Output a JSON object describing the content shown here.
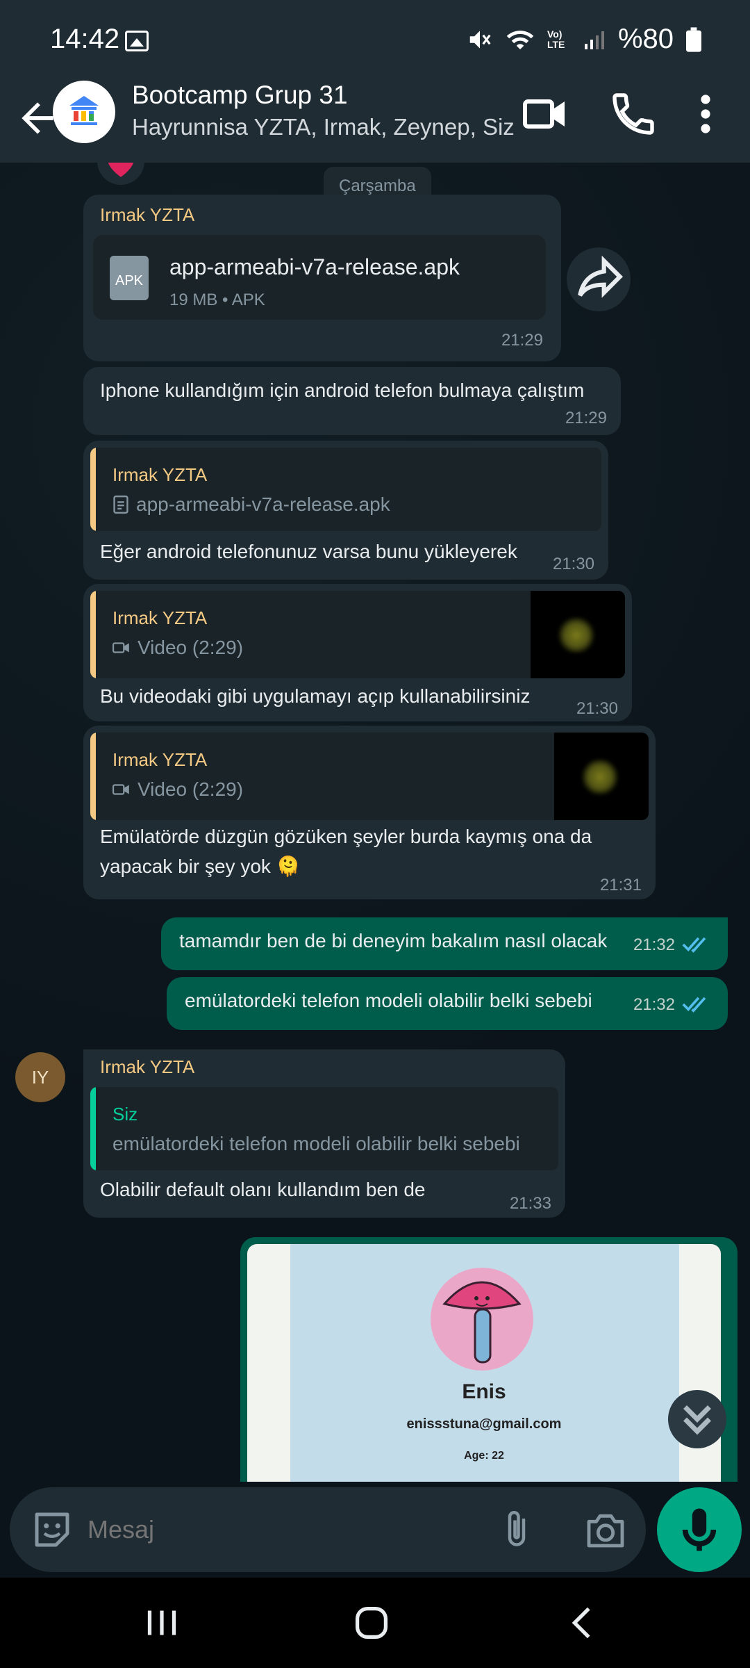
{
  "status_bar": {
    "time": "14:42",
    "battery": "%80",
    "network": "Vo) LTE"
  },
  "header": {
    "title": "Bootcamp Grup 31",
    "subtitle": "Hayrunnisa YZTA, Irmak, Zeynep, Siz"
  },
  "chat": {
    "date_chip": "Çarşamba",
    "messages": [
      {
        "sender": "Irmak YZTA",
        "file_name": "app-armeabi-v7a-release.apk",
        "file_meta": "19 MB • APK",
        "file_icon_label": "APK",
        "time": "21:29"
      },
      {
        "text": "Iphone kullandığım için android telefon bulmaya çalıştım",
        "time": "21:29"
      },
      {
        "quote_name": "Irmak YZTA",
        "quote_text": "app-armeabi-v7a-release.apk",
        "text": "Eğer android telefonunuz varsa bunu yükleyerek",
        "time": "21:30"
      },
      {
        "quote_name": "Irmak YZTA",
        "quote_text": "Video (2:29)",
        "text": "Bu videodaki gibi uygulamayı açıp kullanabilirsiniz",
        "time": "21:30"
      },
      {
        "quote_name": "Irmak YZTA",
        "quote_text": "Video (2:29)",
        "text_line1": "Emülatörde düzgün gözüken şeyler burda kaymış ona da",
        "text_line2": "yapacak bir şey yok 🫠",
        "time": "21:31"
      },
      {
        "text": "tamamdır ben de bi deneyim bakalım nasıl olacak",
        "time": "21:32",
        "outgoing": true
      },
      {
        "text": "emülatordeki telefon modeli olabilir belki sebebi",
        "time": "21:32",
        "outgoing": true
      },
      {
        "avatar": "IY",
        "sender": "Irmak YZTA",
        "quote_name": "Siz",
        "quote_text": "emülatordeki telefon modeli olabilir belki sebebi",
        "text": "Olabilir default olanı kullandım ben de",
        "time": "21:33"
      },
      {
        "image_name": "Enis",
        "image_email": "enissstuna@gmail.com",
        "image_age": "Age: 22",
        "outgoing": true
      }
    ]
  },
  "input": {
    "placeholder": "Mesaj"
  },
  "colors": {
    "incoming_bubble": "#202c33",
    "outgoing_bubble": "#005c4b",
    "accent": "#00a884",
    "sender_name": "#f4c983",
    "read_ticks": "#53bdeb"
  }
}
